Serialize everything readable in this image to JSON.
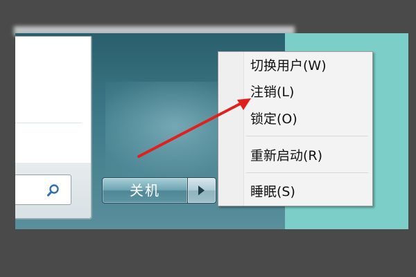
{
  "start_menu": {
    "search": {
      "icon": "magnifier-icon"
    },
    "shutdown_button": {
      "label": "关机"
    },
    "shutdown_arrow": {
      "icon": "right-triangle-icon"
    }
  },
  "shutdown_menu": {
    "items": [
      {
        "label": "切换用户(W)"
      },
      {
        "label": "注销(L)"
      },
      {
        "label": "锁定(O)"
      },
      {
        "label": "重新启动(R)"
      },
      {
        "label": "睡眠(S)"
      }
    ]
  },
  "annotation": {
    "type": "red-arrow",
    "color": "#e0201c",
    "points_to": "注销(L)"
  },
  "colors": {
    "glass": "#3f7a88",
    "desktop": "#7ccfc8",
    "menu_bg": "#f3f3f3",
    "arrow": "#e0201c"
  }
}
